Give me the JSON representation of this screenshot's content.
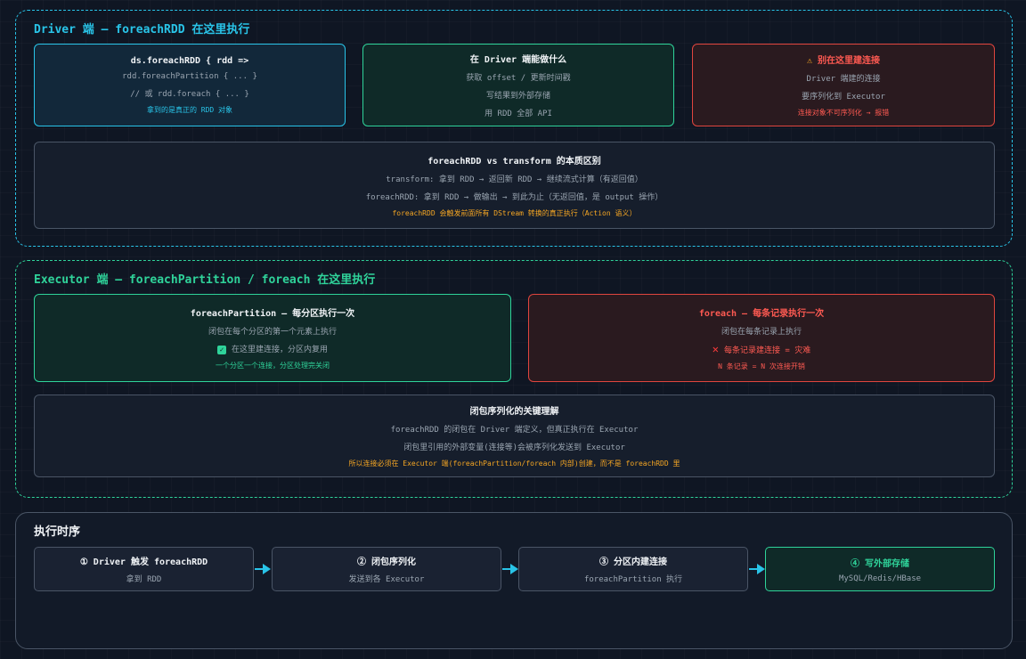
{
  "colors": {
    "cyan": "#29c4e8",
    "green": "#2fd39a",
    "red": "#e0453e",
    "orange": "#f5a623",
    "gray": "#4a5566"
  },
  "driver_section": {
    "title": "Driver 端 — foreachRDD 在这里执行",
    "code_card": {
      "line1": "ds.foreachRDD { rdd =>",
      "line2": "rdd.foreachPartition { ... }",
      "line3": "// 或 rdd.foreach { ... }",
      "note": "拿到的是真正的 RDD 对象"
    },
    "can_do_card": {
      "title": "在 Driver 端能做什么",
      "line1": "获取 offset / 更新时间戳",
      "line2": "写结果到外部存储",
      "line3": "用 RDD 全部 API"
    },
    "warn_card": {
      "icon": "warning-icon",
      "title": "别在这里建连接",
      "line1": "Driver 端建的连接",
      "line2": "要序列化到 Executor",
      "note": "连接对象不可序列化 → 报错"
    },
    "diff_card": {
      "title": "foreachRDD vs transform 的本质区别",
      "line1": "transform: 拿到 RDD → 返回新 RDD → 继续流式计算（有返回值）",
      "line2": "foreachRDD: 拿到 RDD → 做输出 → 到此为止（无返回值，是 output 操作）",
      "note": "foreachRDD 会触发前面所有 DStream 转换的真正执行（Action 语义）"
    }
  },
  "executor_section": {
    "title": "Executor 端 — foreachPartition / foreach 在这里执行",
    "partition_card": {
      "title": "foreachPartition — 每分区执行一次",
      "line1": "闭包在每个分区的第一个元素上执行",
      "check_icon": "check-icon",
      "line2": "在这里建连接，分区内复用",
      "note": "一个分区一个连接，分区处理完关闭"
    },
    "foreach_card": {
      "title": "foreach — 每条记录执行一次",
      "line1": "闭包在每条记录上执行",
      "cross_icon": "cross-icon",
      "line2": "每条记录建连接 = 灾难",
      "note": "N 条记录 = N 次连接开销"
    },
    "closure_card": {
      "title": "闭包序列化的关键理解",
      "line1": "foreachRDD 的闭包在 Driver 端定义，但真正执行在 Executor",
      "line2": "闭包里引用的外部变量(连接等)会被序列化发送到 Executor",
      "note": "所以连接必须在 Executor 端(foreachPartition/foreach 内部)创建，而不是 foreachRDD 里"
    }
  },
  "timeline_section": {
    "title": "执行时序",
    "steps": [
      {
        "title": "① Driver 触发 foreachRDD",
        "sub": "拿到 RDD"
      },
      {
        "title": "② 闭包序列化",
        "sub": "发送到各 Executor"
      },
      {
        "title": "③ 分区内建连接",
        "sub": "foreachPartition 执行"
      },
      {
        "title": "④ 写外部存储",
        "sub": "MySQL/Redis/HBase"
      }
    ]
  }
}
